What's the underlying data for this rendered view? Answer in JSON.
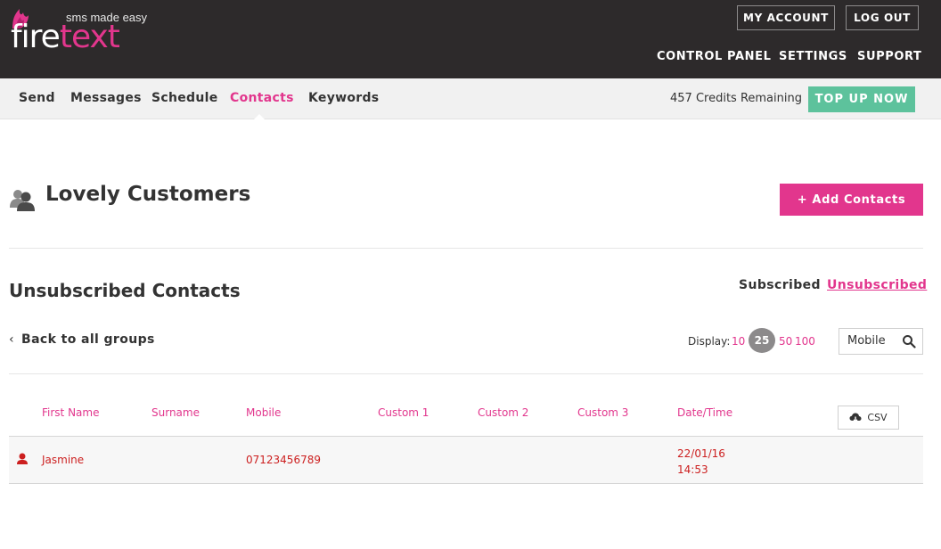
{
  "header": {
    "tagline": "sms made easy",
    "logo_part1": "fire",
    "logo_part2": "text",
    "my_account": "MY ACCOUNT",
    "log_out": "LOG OUT",
    "nav": [
      "CONTROL PANEL",
      "SETTINGS",
      "SUPPORT"
    ]
  },
  "subnav": {
    "items": [
      "Send",
      "Messages",
      "Schedule",
      "Contacts",
      "Keywords"
    ],
    "active": "Contacts",
    "credits": "457 Credits Remaining",
    "top_up": "TOP UP NOW"
  },
  "group": {
    "title": "Lovely Customers",
    "add_button": "+ Add Contacts"
  },
  "section": {
    "title": "Unsubscribed Contacts",
    "tab_subscribed": "Subscribed",
    "tab_unsubscribed": "Unsubscribed",
    "back_link": "Back to all groups",
    "display_label": "Display:",
    "display_options": [
      "10",
      "25",
      "50",
      "100"
    ],
    "display_selected": "25",
    "search_placeholder": "Mobile"
  },
  "table": {
    "columns": [
      "First Name",
      "Surname",
      "Mobile",
      "Custom 1",
      "Custom 2",
      "Custom 3",
      "Date/Time"
    ],
    "csv_label": "CSV",
    "rows": [
      {
        "first_name": "Jasmine",
        "surname": "",
        "mobile": "07123456789",
        "custom1": "",
        "custom2": "",
        "custom3": "",
        "date": "22/01/16",
        "time": "14:53"
      }
    ]
  },
  "colors": {
    "brand_pink": "#e2368d",
    "topup_green": "#5dc29c",
    "header_dark": "#2d2a2b",
    "unsub_red": "#cc1f1f"
  }
}
